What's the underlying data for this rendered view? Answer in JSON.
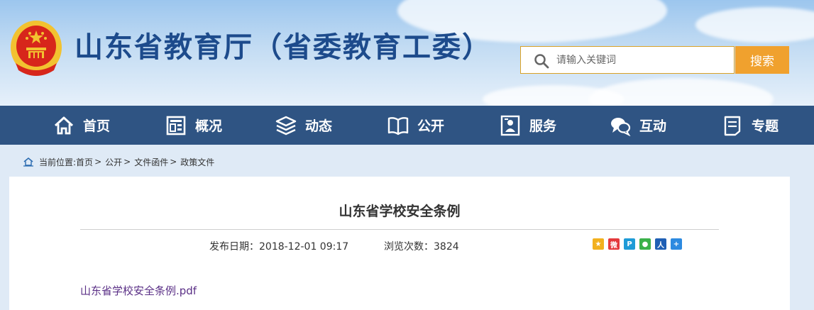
{
  "header": {
    "site_title": "山东省教育厅（省委教育工委）",
    "search": {
      "placeholder": "请输入关键词",
      "value": "",
      "button_label": "搜索"
    },
    "colors": {
      "title": "#1d4b8c",
      "search_button": "#f0a12e",
      "emblem_red": "#d7261b",
      "emblem_gold": "#f2c230"
    }
  },
  "nav": {
    "background": "#2f5483",
    "items": [
      {
        "label": "首页",
        "icon": "home-icon"
      },
      {
        "label": "概况",
        "icon": "building-icon"
      },
      {
        "label": "动态",
        "icon": "stack-icon"
      },
      {
        "label": "公开",
        "icon": "book-icon"
      },
      {
        "label": "服务",
        "icon": "service-icon"
      },
      {
        "label": "互动",
        "icon": "chat-icon"
      },
      {
        "label": "专题",
        "icon": "document-icon"
      }
    ]
  },
  "breadcrumb": {
    "prefix": "当前位置:",
    "items": [
      "首页",
      "公开",
      "文件函件",
      "政策文件"
    ],
    "separator": ">"
  },
  "article": {
    "title": "山东省学校安全条例",
    "publish_label": "发布日期：",
    "publish_date": "2018-12-01 09:17",
    "views_label": "浏览次数：",
    "views": "3824",
    "share_icons": [
      "qzone-share-icon",
      "weibo-share-icon",
      "tencent-share-icon",
      "wechat-share-icon",
      "renren-share-icon",
      "more-share-icon"
    ],
    "attachment": "山东省学校安全条例.pdf",
    "attachment_color": "#5a2f86"
  }
}
